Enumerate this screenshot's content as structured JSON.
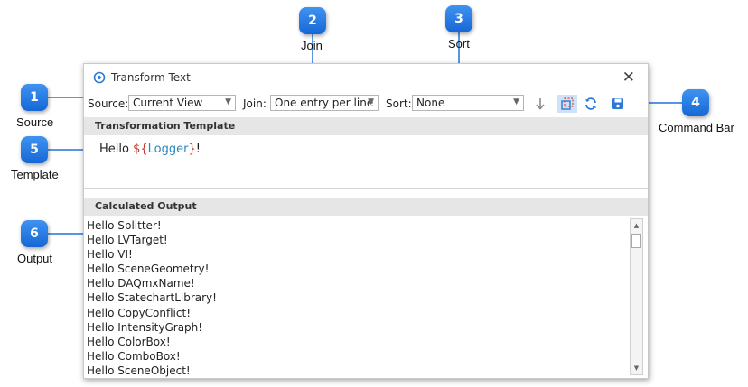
{
  "window": {
    "title": "Transform Text",
    "close_glyph": "✕"
  },
  "toolbar": {
    "source_label": "Source:",
    "source_value": "Current View",
    "join_label": "Join:",
    "join_value": "One entry per line",
    "sort_label": "Sort:",
    "sort_value": "None",
    "icons": [
      "sort-direction-icon",
      "select-icon",
      "refresh-icon",
      "save-icon"
    ]
  },
  "template": {
    "header": "Transformation Template",
    "prefix": "Hello ",
    "var_open": "${",
    "var_name": "Logger",
    "var_close": "}",
    "suffix": "!"
  },
  "output": {
    "header": "Calculated Output",
    "lines": [
      "Hello Splitter!",
      "Hello LVTarget!",
      "Hello VI!",
      "Hello SceneGeometry!",
      "Hello DAQmxName!",
      "Hello StatechartLibrary!",
      "Hello CopyConflict!",
      "Hello IntensityGraph!",
      "Hello ColorBox!",
      "Hello ComboBox!",
      "Hello SceneObject!"
    ]
  },
  "callouts": [
    {
      "number": "1",
      "label": "Source"
    },
    {
      "number": "2",
      "label": "Join"
    },
    {
      "number": "3",
      "label": "Sort"
    },
    {
      "number": "4",
      "label": "Command Bar"
    },
    {
      "number": "5",
      "label": "Template"
    },
    {
      "number": "6",
      "label": "Output"
    }
  ],
  "colors": {
    "callout": "#1f74e0",
    "variable_delimiter": "#c0392b",
    "variable_name": "#2e86c1",
    "active_button": "#cfe3f8"
  }
}
